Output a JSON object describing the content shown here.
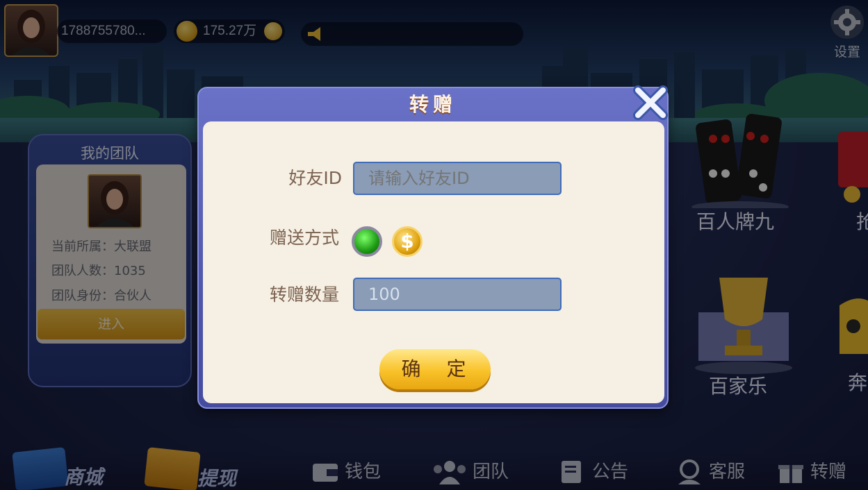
{
  "top_bar": {
    "user_id": "1788755780...",
    "coins": "175.27万",
    "settings_label": "设置"
  },
  "team_panel": {
    "title": "我的团队",
    "belong": "当前所属：大联盟",
    "members": "团队人数：1035",
    "role": "团队身份：合伙人",
    "enter": "进入"
  },
  "games": [
    {
      "label": "百人牌九"
    },
    {
      "label": "百家乐"
    },
    {
      "label": "抢"
    },
    {
      "label": "奔"
    }
  ],
  "bottom_nav": [
    {
      "label": "商城",
      "icon": "shop-card-icon"
    },
    {
      "label": "提现",
      "icon": "cash-card-icon"
    },
    {
      "label": "钱包",
      "icon": "wallet-icon"
    },
    {
      "label": "团队",
      "icon": "team-icon"
    },
    {
      "label": "公告",
      "icon": "notice-icon"
    },
    {
      "label": "客服",
      "icon": "service-icon"
    },
    {
      "label": "转赠",
      "icon": "gift-icon"
    }
  ],
  "modal": {
    "title": "转赠",
    "friend_id_label": "好友ID",
    "friend_id_placeholder": "请输入好友ID",
    "method_label": "赠送方式",
    "amount_label": "转赠数量",
    "amount_value": "100",
    "confirm_label": "确 定",
    "coin_symbol": "$"
  },
  "colors": {
    "accent_gold": "#f9c229",
    "modal_frame": "#5a62b6",
    "panel_bg": "#f5f0e3"
  }
}
